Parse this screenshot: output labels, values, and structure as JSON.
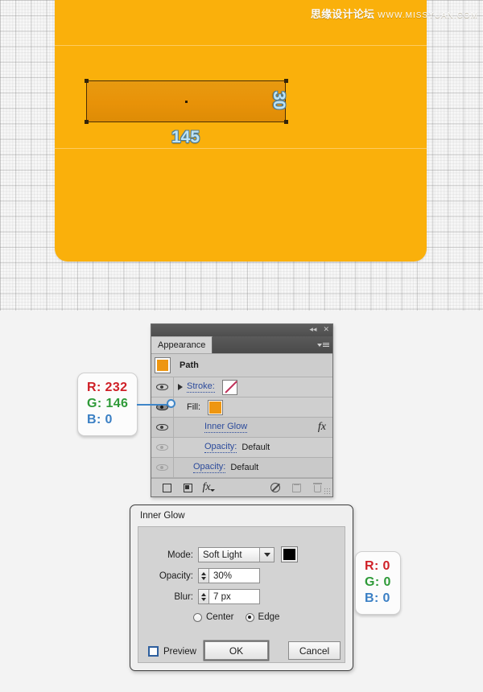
{
  "canvas": {
    "watermark_cn": "思缘设计论坛",
    "watermark_url": "WWW.MISSYUAN.COM",
    "shape_color": "#FAB00B",
    "selection_fill_color": "#E89208",
    "dimension_width": "145",
    "dimension_height": "30",
    "dimension_label_color": "#BEE3F5"
  },
  "appearance_panel": {
    "title_collapse_icon": "collapse-icon",
    "title_close_icon": "close-icon",
    "tab_label": "Appearance",
    "menu_icon": "panel-menu-icon",
    "path_row": {
      "label": "Path",
      "swatch_color": "#EE9611"
    },
    "rows": [
      {
        "label": "Stroke:",
        "value": "",
        "swatch": "none",
        "visible": true,
        "has_disclosure": true
      },
      {
        "label": "Fill:",
        "value": "",
        "swatch": "#EE9611",
        "visible": true,
        "has_disclosure": false
      },
      {
        "label": "Inner Glow",
        "value": "",
        "swatch": null,
        "visible": true,
        "fx_marker": "fx"
      },
      {
        "label": "Opacity:",
        "value": "Default",
        "swatch": null,
        "visible": false
      },
      {
        "label": "Opacity:",
        "value": "Default",
        "swatch": null,
        "visible": false
      }
    ],
    "footer_icons": [
      "add-new-stroke-icon",
      "add-new-fill-icon",
      "add-effect-icon",
      "clear-appearance-icon",
      "duplicate-item-icon",
      "delete-item-icon",
      "resize-grip-icon"
    ]
  },
  "fill_callout": {
    "r_label": "R:",
    "r_value": "232",
    "g_label": "G:",
    "g_value": "146",
    "b_label": "B:",
    "b_value": "0"
  },
  "glow_callout": {
    "r_label": "R:",
    "r_value": "0",
    "g_label": "G:",
    "g_value": "0",
    "b_label": "B:",
    "b_value": "0"
  },
  "inner_glow_dialog": {
    "title": "Inner Glow",
    "mode_label": "Mode:",
    "mode_value": "Soft Light",
    "mode_options": [
      "Soft Light"
    ],
    "color_swatch": "#000000",
    "opacity_label": "Opacity:",
    "opacity_value": "30%",
    "blur_label": "Blur:",
    "blur_value": "7 px",
    "radio_center_label": "Center",
    "radio_edge_label": "Edge",
    "radio_selected": "Edge",
    "preview_label": "Preview",
    "preview_checked": false,
    "ok_label": "OK",
    "cancel_label": "Cancel"
  }
}
